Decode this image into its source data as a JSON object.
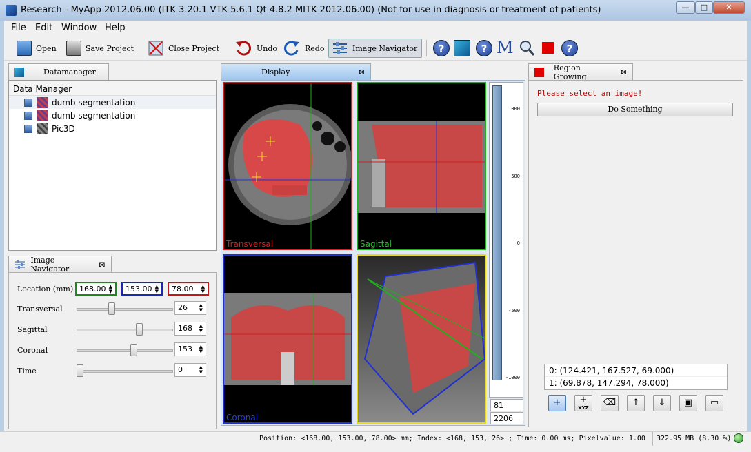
{
  "window": {
    "title": "Research - MyApp 2012.06.00 (ITK 3.20.1  VTK 5.6.1 Qt 4.8.2 MITK 2012.06.00) (Not for use in diagnosis or treatment of patients)",
    "minimize": "—",
    "maximize": "□",
    "close": "✕"
  },
  "menu": [
    "File",
    "Edit",
    "Window",
    "Help"
  ],
  "toolbar": {
    "open": "Open",
    "save_project": "Save Project",
    "close_project": "Close Project",
    "undo": "Undo",
    "redo": "Redo",
    "image_navigator": "Image Navigator",
    "m_label": "M"
  },
  "datamanager": {
    "tab": "Datamanager",
    "header": "Data Manager",
    "items": [
      {
        "label": "dumb segmentation"
      },
      {
        "label": "dumb segmentation"
      },
      {
        "label": "Pic3D"
      }
    ]
  },
  "navigator": {
    "tab": "Image Navigator",
    "location_label": "Location (mm)",
    "loc_x": "168.00",
    "loc_y": "153.00",
    "loc_z": "78.00",
    "transversal_label": "Transversal",
    "transversal_value": "26",
    "transversal_level": 0.35,
    "sagittal_label": "Sagittal",
    "sagittal_value": "168",
    "sagittal_level": 0.66,
    "coronal_label": "Coronal",
    "coronal_value": "153",
    "coronal_level": 0.6,
    "time_label": "Time",
    "time_value": "0",
    "time_level": 0
  },
  "display": {
    "tab": "Display",
    "views": {
      "transversal": "Transversal",
      "sagittal": "Sagittal",
      "coronal": "Coronal"
    },
    "levelwindow": {
      "ticks": [
        "1000",
        "500",
        "0",
        "-500",
        "-1000"
      ],
      "level": "81",
      "window": "2206"
    }
  },
  "region_growing": {
    "tab": "Region Growing",
    "warning": "Please select an image!",
    "button": "Do Something",
    "points": [
      "0: (124.421, 167.527, 69.000)",
      "1: (69.878, 147.294, 78.000)"
    ],
    "xyz_label": "XYZ"
  },
  "status": {
    "text": "Position: <168.00, 153.00, 78.00> mm; Index: <168, 153, 26> ; Time: 0.00 ms; Pixelvalue: 1.00",
    "memory": "322.95 MB (8.30 %)"
  },
  "colors": {
    "transversal": "#d02020",
    "sagittal": "#20b020",
    "coronal": "#2030d0",
    "threed": "#e8d820",
    "warning": "#c00000"
  }
}
